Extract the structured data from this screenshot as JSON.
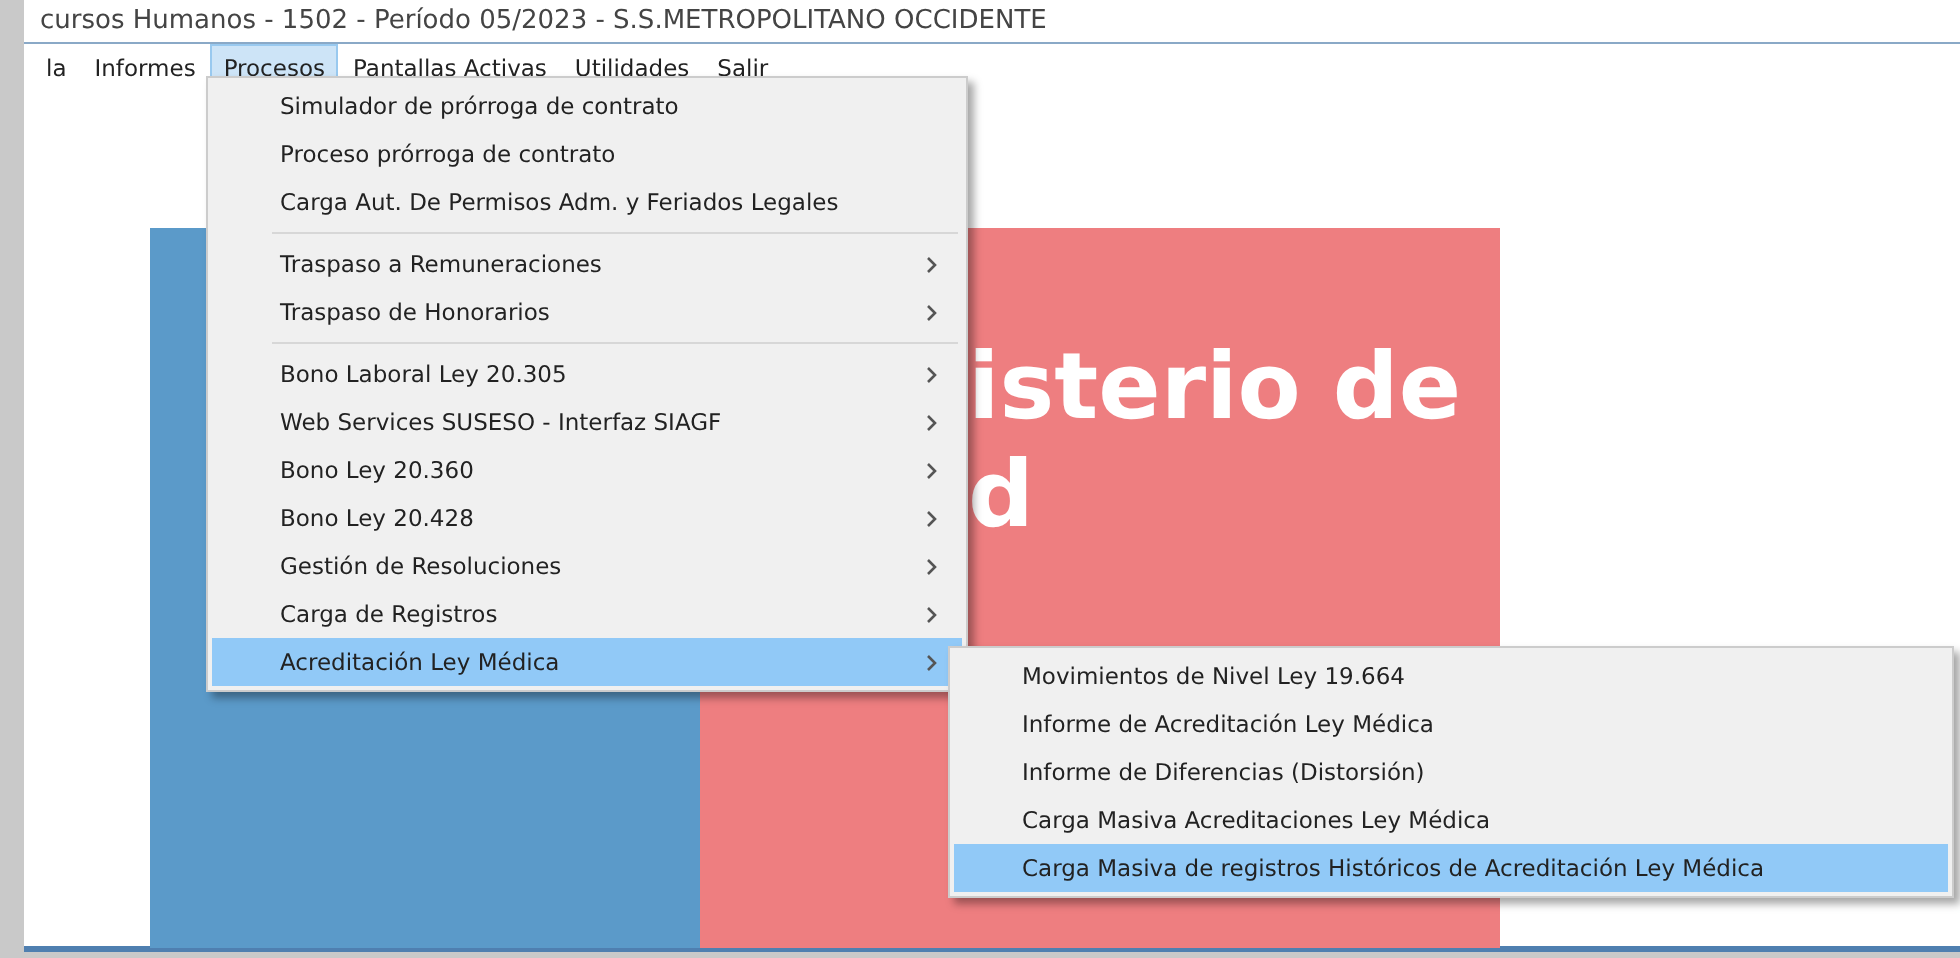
{
  "window": {
    "title": "cursos Humanos - 1502 - Período 05/2023 - S.S.METROPOLITANO OCCIDENTE"
  },
  "menu_bar": [
    {
      "label": "la",
      "selected": false
    },
    {
      "label": "Informes",
      "selected": false
    },
    {
      "label": "Procesos",
      "selected": true
    },
    {
      "label": "Pantallas Activas",
      "selected": false
    },
    {
      "label": "Utilidades",
      "selected": false
    },
    {
      "label": "Salir",
      "selected": false
    }
  ],
  "banner": {
    "lines": [
      "isterio de",
      "d"
    ]
  },
  "dropdown": {
    "items": [
      {
        "kind": "item",
        "label": "Simulador de prórroga de contrato",
        "has_submenu": false,
        "selected": false
      },
      {
        "kind": "item",
        "label": "Proceso prórroga de contrato",
        "has_submenu": false,
        "selected": false
      },
      {
        "kind": "item",
        "label": "Carga Aut. De Permisos Adm. y Feriados Legales",
        "has_submenu": false,
        "selected": false
      },
      {
        "kind": "separator"
      },
      {
        "kind": "item",
        "label": "Traspaso a Remuneraciones",
        "has_submenu": true,
        "selected": false
      },
      {
        "kind": "item",
        "label": "Traspaso de Honorarios",
        "has_submenu": true,
        "selected": false
      },
      {
        "kind": "separator"
      },
      {
        "kind": "item",
        "label": "Bono Laboral Ley 20.305",
        "has_submenu": true,
        "selected": false
      },
      {
        "kind": "item",
        "label": "Web Services SUSESO - Interfaz SIAGF",
        "has_submenu": true,
        "selected": false
      },
      {
        "kind": "item",
        "label": "Bono Ley 20.360",
        "has_submenu": true,
        "selected": false
      },
      {
        "kind": "item",
        "label": "Bono Ley 20.428",
        "has_submenu": true,
        "selected": false
      },
      {
        "kind": "item",
        "label": "Gestión de Resoluciones",
        "has_submenu": true,
        "selected": false
      },
      {
        "kind": "item",
        "label": "Carga de Registros",
        "has_submenu": true,
        "selected": false
      },
      {
        "kind": "item",
        "label": "Acreditación Ley Médica",
        "has_submenu": true,
        "selected": true
      }
    ]
  },
  "submenu": {
    "items": [
      {
        "label": "Movimientos de Nivel Ley 19.664",
        "selected": false
      },
      {
        "label": "Informe de Acreditación Ley Médica",
        "selected": false
      },
      {
        "label": "Informe de Diferencias (Distorsión)",
        "selected": false
      },
      {
        "label": "Carga Masiva Acreditaciones Ley Médica",
        "selected": false
      },
      {
        "label": "Carga Masiva de registros Históricos de Acreditación Ley Médica",
        "selected": true
      }
    ]
  }
}
